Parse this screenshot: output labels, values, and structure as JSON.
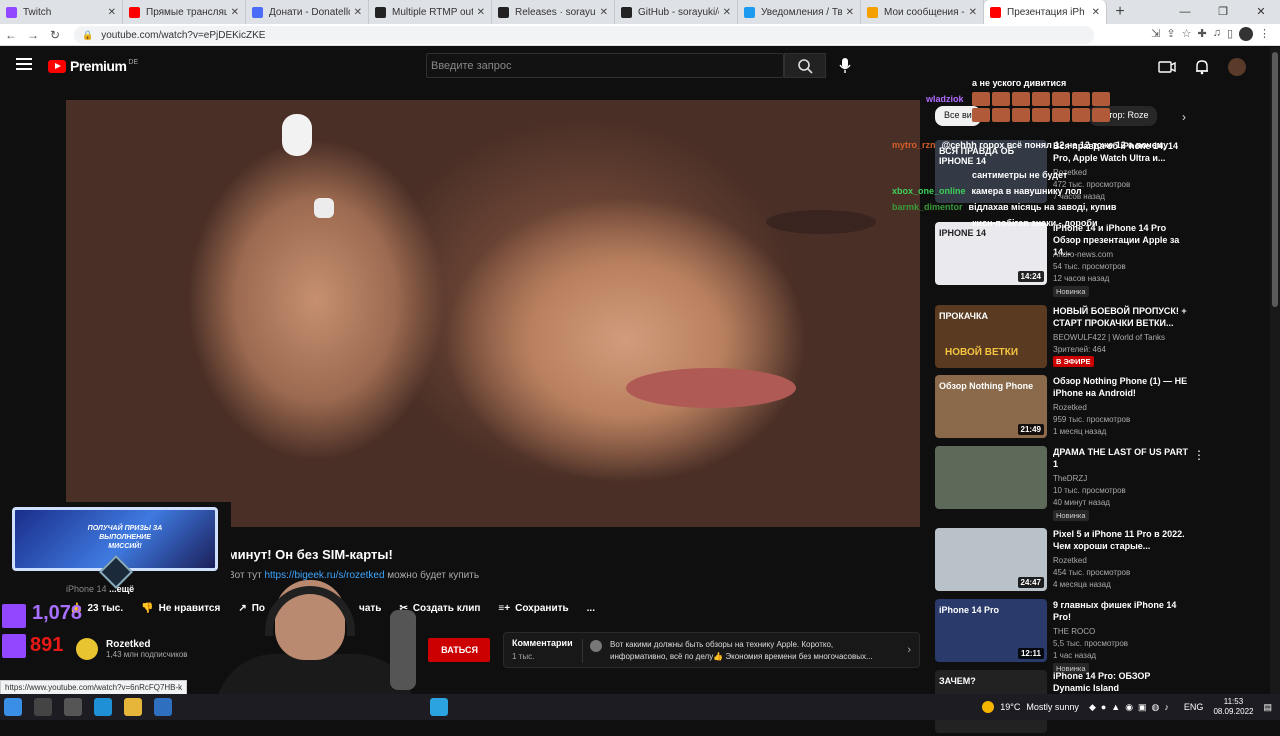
{
  "browser": {
    "tabs": [
      {
        "label": "Twitch",
        "color": "#9146ff"
      },
      {
        "label": "Прямые трансляции",
        "color": "#ff0000"
      },
      {
        "label": "Донати - Donatello",
        "color": "#4a6cf7"
      },
      {
        "label": "Multiple RTMP output",
        "color": "#222222"
      },
      {
        "label": "Releases · sorayuki/ob",
        "color": "#222222"
      },
      {
        "label": "GitHub - sorayuki/obs",
        "color": "#222222"
      },
      {
        "label": "Уведомления / Твитт",
        "color": "#1d9bf0"
      },
      {
        "label": "Мои сообщения - Па",
        "color": "#f4a000"
      },
      {
        "label": "Презентация iPh",
        "color": "#ff0000"
      }
    ],
    "url": "youtube.com/watch?v=ePjDEKicZKE",
    "status_url": "https://www.youtube.com/watch?v=6nRcFQ7HB-k"
  },
  "header": {
    "logo_text": "Premium",
    "logo_region": "DE",
    "search_placeholder": "Введите запрос"
  },
  "video": {
    "title": "минут! Он без SIM-карты!",
    "desc_prefix": "Вот тут",
    "desc_link": "https://bigeek.ru/s/rozetked",
    "desc_suffix": "можно будет купить",
    "tags_text": "iPhone 14",
    "more": "...ещё"
  },
  "actions": {
    "likes": "23 тыс.",
    "dislike": "Не нравится",
    "share": "По",
    "clip_partial": "чать",
    "clip": "Создать клип",
    "save": "Сохранить",
    "more": "..."
  },
  "channel": {
    "name": "Rozetked",
    "subs": "1,43 млн подписчиков",
    "subscribe": "ВАТЬСЯ"
  },
  "comments": {
    "label": "Комментарии",
    "count": "1 тыс.",
    "text": "Вот какими должны быть обзоры на технику Apple. Коротко, информативно, всё по делу👍 Экономия времени без многочасовых..."
  },
  "filters": {
    "chips": [
      "Все ви",
      "Автор: Roze"
    ]
  },
  "recommendations": [
    {
      "title": "Вся правда об iPhone 14, 14 Pro, Apple Watch Ultra и...",
      "channel": "Rozetked",
      "views": "472 тыс. просмотров",
      "age": "7 часов назад",
      "badge": "",
      "duration": "",
      "thumb": "#333a45"
    },
    {
      "title": "iPhone 14 и iPhone 14 Pro Обзор презентации Apple за 14...",
      "channel": "Andro-news.com",
      "views": "54 тыс. просмотров",
      "age": "12 часов назад",
      "badge": "Новинка",
      "duration": "14:24",
      "thumb": "#e9e9ee"
    },
    {
      "title": "НОВЫЙ БОЕВОЙ ПРОПУСК! + СТАРТ ПРОКАЧКИ ВЕТКИ...",
      "channel": "BEOWULF422 | World of Tanks",
      "views": "Зрителей: 464",
      "age": "",
      "badge": "",
      "live": "В ЭФИРЕ",
      "duration": "",
      "thumb": "#5a3a20"
    },
    {
      "title": "Обзор Nothing Phone (1) — НЕ iPhone на Android!",
      "channel": "Rozetked",
      "views": "959 тыс. просмотров",
      "age": "1 месяц назад",
      "badge": "",
      "duration": "21:49",
      "thumb": "#8a6a4a"
    },
    {
      "title": "ДРАМА THE LAST OF US PART 1",
      "channel": "TheDRZJ",
      "views": "10 тыс. просмотров",
      "age": "40 минут назад",
      "badge": "Новинка",
      "duration": "",
      "thumb": "#5d6a5a"
    },
    {
      "title": "Pixel 5 и iPhone 11 Pro в 2022. Чем хороши старые...",
      "channel": "Rozetked",
      "views": "454 тыс. просмотров",
      "age": "4 месяца назад",
      "badge": "",
      "duration": "24:47",
      "thumb": "#b8c2c8"
    },
    {
      "title": "9 главных фишек iPhone 14 Pro!",
      "channel": "THE ROCO",
      "views": "5,5 тыс. просмотров",
      "age": "1 час назад",
      "badge": "Новинка",
      "duration": "12:11",
      "thumb": "#2a3a6a"
    },
    {
      "title": "iPhone 14 Pro: ОБЗОР Dynamic Island",
      "channel": "",
      "views": "",
      "age": "",
      "badge": "",
      "duration": "",
      "thumb": "#222222"
    }
  ],
  "thumb_texts": {
    "t1": "ВСЯ ПРАВДА ОБ IPHONE 14",
    "t2": "IPHONE 14",
    "t3a": "ПРОКАЧКА",
    "t3b": "НОВОЙ ВЕТКИ",
    "t4": "Обзор Nothing Phone",
    "t7": "iPhone 14 Pro",
    "t8": "ЗАЧЕМ?"
  },
  "chat": [
    {
      "user": "",
      "text": "а не уского дивитися",
      "color": "#ffffff"
    },
    {
      "user": "wladziok",
      "text": "",
      "color": "#b06cff"
    },
    {
      "user": "mytro_rzn",
      "text": "@cehhh горох всё понял 12 не 12 тоже 12 а почему",
      "color": "#d35d2a"
    },
    {
      "user": "",
      "text": "сантиметры не будет",
      "color": "#ffffff"
    },
    {
      "user": "xbox_one_online",
      "text": "камера в навушнику лол",
      "color": "#3ecf5a"
    },
    {
      "user": "barmk_dimentor",
      "text": "відлахав місяць на заводі, купив",
      "color": "#3a9a3a"
    },
    {
      "user": "",
      "text": "кисн-побігав знаки - дороби",
      "color": "#ffffff"
    }
  ],
  "overlay": {
    "promo": "ПОЛУЧАЙ ПРИЗЫ ЗА ВЫПОЛНЕНИЕ МИССИЙ!",
    "viewers": "1,078",
    "followers": "891"
  },
  "taskbar": {
    "temp": "19°C",
    "weather": "Mostly sunny",
    "lang": "ENG",
    "time": "11:53",
    "date": "08.09.2022"
  }
}
